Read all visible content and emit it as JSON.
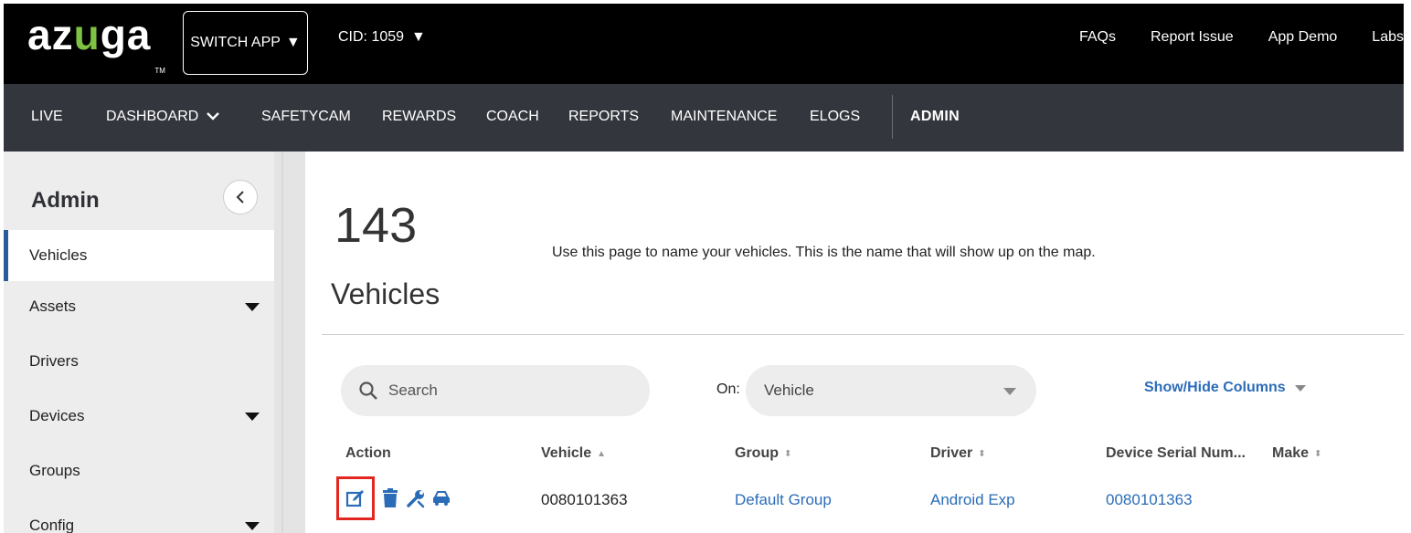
{
  "header": {
    "logo_pre": "az",
    "logo_u": "u",
    "logo_post": "ga",
    "logo_tm": "TM",
    "switch_app": "SWITCH APP",
    "cid": "CID: 1059",
    "links": [
      "FAQs",
      "Report Issue",
      "App Demo",
      "Labs"
    ]
  },
  "nav": {
    "items": [
      "LIVE",
      "DASHBOARD",
      "SAFETYCAM",
      "REWARDS",
      "COACH",
      "REPORTS",
      "MAINTENANCE",
      "ELOGS"
    ],
    "active": "ADMIN"
  },
  "sidebar": {
    "title": "Admin",
    "items": [
      {
        "label": "Vehicles"
      },
      {
        "label": "Assets"
      },
      {
        "label": "Drivers"
      },
      {
        "label": "Devices"
      },
      {
        "label": "Groups"
      },
      {
        "label": "Config"
      }
    ]
  },
  "main": {
    "count": "143",
    "count_label": "Vehicles",
    "description": "Use this page to name your vehicles. This is the name that will show up on the map.",
    "search_placeholder": "Search",
    "on_label": "On:",
    "on_value": "Vehicle",
    "show_hide": "Show/Hide Columns",
    "columns": {
      "action": "Action",
      "vehicle": "Vehicle",
      "group": "Group",
      "driver": "Driver",
      "device_serial": "Device Serial Num...",
      "make": "Make"
    },
    "rows": [
      {
        "vehicle": "0080101363",
        "group": "Default Group",
        "driver": "Android Exp",
        "device_serial": "0080101363"
      }
    ]
  },
  "colors": {
    "accent_blue": "#2b6cb8",
    "logo_green": "#7dc242",
    "highlight_red": "#e3261f",
    "nav_bg": "#33373d"
  }
}
